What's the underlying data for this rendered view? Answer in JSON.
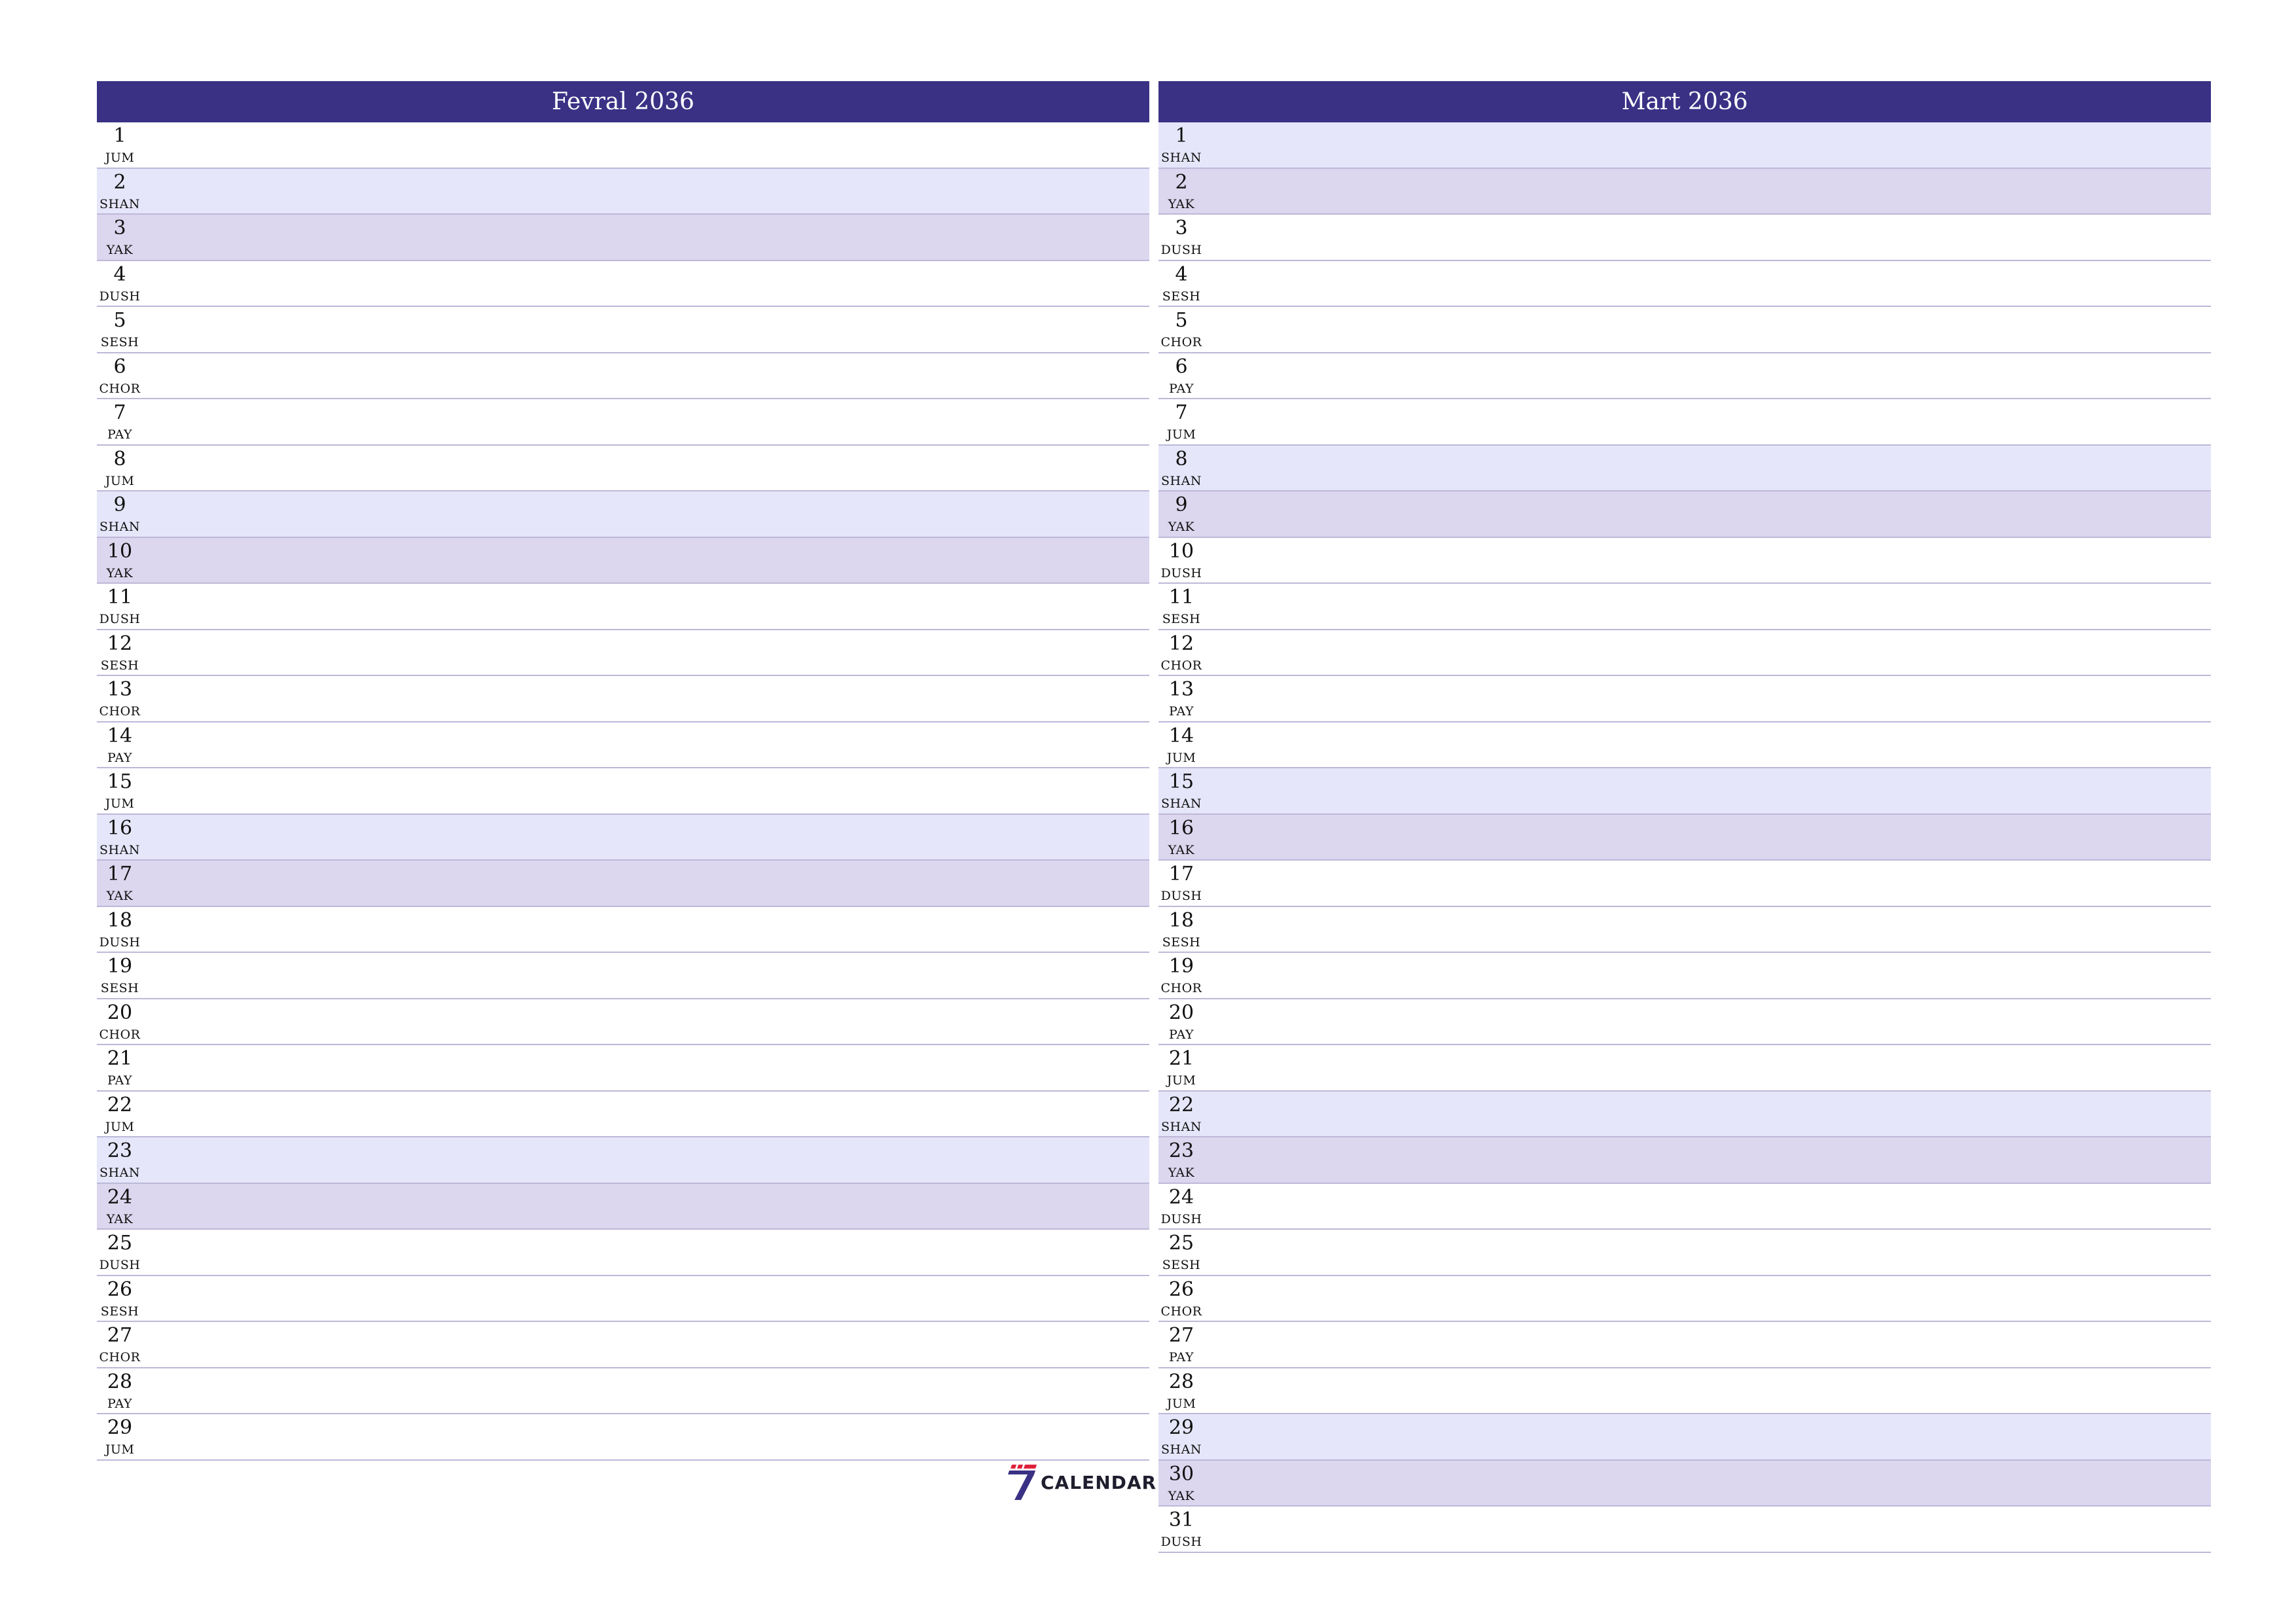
{
  "months": [
    {
      "title": "Fevral 2036",
      "days": [
        {
          "num": "1",
          "name": "JUM"
        },
        {
          "num": "2",
          "name": "SHAN"
        },
        {
          "num": "3",
          "name": "YAK"
        },
        {
          "num": "4",
          "name": "DUSH"
        },
        {
          "num": "5",
          "name": "SESH"
        },
        {
          "num": "6",
          "name": "CHOR"
        },
        {
          "num": "7",
          "name": "PAY"
        },
        {
          "num": "8",
          "name": "JUM"
        },
        {
          "num": "9",
          "name": "SHAN"
        },
        {
          "num": "10",
          "name": "YAK"
        },
        {
          "num": "11",
          "name": "DUSH"
        },
        {
          "num": "12",
          "name": "SESH"
        },
        {
          "num": "13",
          "name": "CHOR"
        },
        {
          "num": "14",
          "name": "PAY"
        },
        {
          "num": "15",
          "name": "JUM"
        },
        {
          "num": "16",
          "name": "SHAN"
        },
        {
          "num": "17",
          "name": "YAK"
        },
        {
          "num": "18",
          "name": "DUSH"
        },
        {
          "num": "19",
          "name": "SESH"
        },
        {
          "num": "20",
          "name": "CHOR"
        },
        {
          "num": "21",
          "name": "PAY"
        },
        {
          "num": "22",
          "name": "JUM"
        },
        {
          "num": "23",
          "name": "SHAN"
        },
        {
          "num": "24",
          "name": "YAK"
        },
        {
          "num": "25",
          "name": "DUSH"
        },
        {
          "num": "26",
          "name": "SESH"
        },
        {
          "num": "27",
          "name": "CHOR"
        },
        {
          "num": "28",
          "name": "PAY"
        },
        {
          "num": "29",
          "name": "JUM"
        }
      ]
    },
    {
      "title": "Mart 2036",
      "days": [
        {
          "num": "1",
          "name": "SHAN"
        },
        {
          "num": "2",
          "name": "YAK"
        },
        {
          "num": "3",
          "name": "DUSH"
        },
        {
          "num": "4",
          "name": "SESH"
        },
        {
          "num": "5",
          "name": "CHOR"
        },
        {
          "num": "6",
          "name": "PAY"
        },
        {
          "num": "7",
          "name": "JUM"
        },
        {
          "num": "8",
          "name": "SHAN"
        },
        {
          "num": "9",
          "name": "YAK"
        },
        {
          "num": "10",
          "name": "DUSH"
        },
        {
          "num": "11",
          "name": "SESH"
        },
        {
          "num": "12",
          "name": "CHOR"
        },
        {
          "num": "13",
          "name": "PAY"
        },
        {
          "num": "14",
          "name": "JUM"
        },
        {
          "num": "15",
          "name": "SHAN"
        },
        {
          "num": "16",
          "name": "YAK"
        },
        {
          "num": "17",
          "name": "DUSH"
        },
        {
          "num": "18",
          "name": "SESH"
        },
        {
          "num": "19",
          "name": "CHOR"
        },
        {
          "num": "20",
          "name": "PAY"
        },
        {
          "num": "21",
          "name": "JUM"
        },
        {
          "num": "22",
          "name": "SHAN"
        },
        {
          "num": "23",
          "name": "YAK"
        },
        {
          "num": "24",
          "name": "DUSH"
        },
        {
          "num": "25",
          "name": "SESH"
        },
        {
          "num": "26",
          "name": "CHOR"
        },
        {
          "num": "27",
          "name": "PAY"
        },
        {
          "num": "28",
          "name": "JUM"
        },
        {
          "num": "29",
          "name": "SHAN"
        },
        {
          "num": "30",
          "name": "YAK"
        },
        {
          "num": "31",
          "name": "DUSH"
        }
      ]
    }
  ],
  "brand": {
    "text": "CALENDAR",
    "icon": "seven-logo-icon"
  },
  "colors": {
    "header": "#3a3185",
    "saturday_row": "#e6e6fa",
    "sunday_row": "#dcd6ee",
    "row_divider": "#bdb8d8"
  }
}
